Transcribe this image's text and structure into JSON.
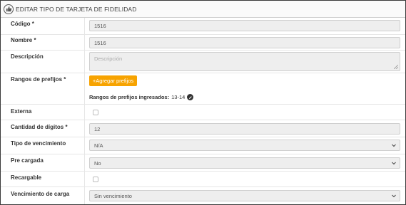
{
  "header": {
    "title": "EDITAR TIPO DE TARJETA DE FIDELIDAD"
  },
  "fields": {
    "codigo": {
      "label": "Código *",
      "value": "1516"
    },
    "nombre": {
      "label": "Nombre *",
      "value": "1516"
    },
    "descripcion": {
      "label": "Descripción",
      "placeholder": "Descripción"
    },
    "rangos": {
      "label": "Rangos de prefijos *",
      "button_label": "+Agregar prefijos",
      "ingresados_label": "Rangos de prefijos ingresados:",
      "ingresados_value": "13-14"
    },
    "externa": {
      "label": "Externa",
      "checked": false
    },
    "cantidad": {
      "label": "Cantidad de dígitos *",
      "value": "12"
    },
    "vencimiento": {
      "label": "Tipo de vencimiento",
      "value": "N/A"
    },
    "precargada": {
      "label": "Pre cargada",
      "value": "No"
    },
    "recargable": {
      "label": "Recargable",
      "checked": false
    },
    "venc_carga": {
      "label": "Vencimiento de carga",
      "value": "Sin vencimiento"
    }
  },
  "colors": {
    "accent": "#f7a300",
    "field_bg": "#eeeeee",
    "border": "#cfcfcf"
  }
}
